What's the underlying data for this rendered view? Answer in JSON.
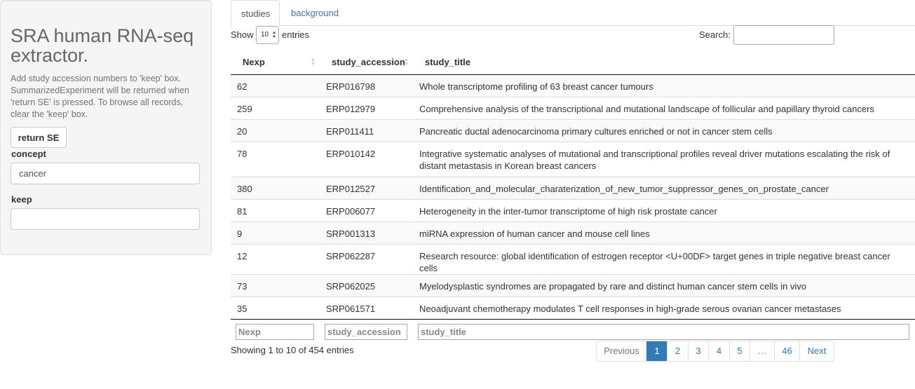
{
  "sidebar": {
    "title": "SRA human RNA-seq extractor.",
    "help": "Add study accession numbers to 'keep' box. SummarizedExperiment will be returned when 'return SE' is pressed. To browse all records, clear the 'keep' box.",
    "return_button": "return SE",
    "concept_label": "concept",
    "concept_value": "cancer",
    "keep_label": "keep",
    "keep_value": ""
  },
  "tabs": [
    {
      "label": "studies",
      "active": true
    },
    {
      "label": "background",
      "active": false
    }
  ],
  "table_controls": {
    "show_label": "Show",
    "length_value": "10",
    "entries_label": "entries",
    "search_label": "Search:",
    "search_value": ""
  },
  "table": {
    "columns": [
      "Nexp",
      "study_accession",
      "study_title"
    ],
    "rows": [
      [
        "62",
        "ERP016798",
        "Whole transcriptome profiling of 63 breast cancer tumours"
      ],
      [
        "259",
        "ERP012979",
        "Comprehensive analysis of the transcriptional and mutational landscape of follicular and papillary thyroid cancers"
      ],
      [
        "20",
        "ERP011411",
        "Pancreatic ductal adenocarcinoma primary cultures enriched or not in cancer stem cells"
      ],
      [
        "78",
        "ERP010142",
        "Integrative systematic analyses of mutational and transcriptional profiles reveal driver mutations escalating the risk of distant metastasis in Korean breast cancers"
      ],
      [
        "380",
        "ERP012527",
        "Identification_and_molecular_charaterization_of_new_tumor_suppressor_genes_on_prostate_cancer"
      ],
      [
        "81",
        "ERP006077",
        "Heterogeneity in the inter-tumor transcriptome of high risk prostate cancer"
      ],
      [
        "9",
        "SRP001313",
        "miRNA expression of human cancer and mouse cell lines"
      ],
      [
        "12",
        "SRP062287",
        "Research resource: global identification of estrogen receptor <U+00DF> target genes in triple negative breast cancer cells"
      ],
      [
        "73",
        "SRP062025",
        "Myelodysplastic syndromes are propagated by rare and distinct human cancer stem cells in vivo"
      ],
      [
        "35",
        "SRP061571",
        "Neoadjuvant chemotherapy modulates T cell responses in high-grade serous ovarian cancer metastases"
      ]
    ],
    "filter_placeholders": [
      "Nexp",
      "study_accession",
      "study_title"
    ]
  },
  "footer": {
    "info": "Showing 1 to 10 of 454 entries",
    "pagination": [
      "Previous",
      "1",
      "2",
      "3",
      "4",
      "5",
      "…",
      "46",
      "Next"
    ],
    "current_page": "1"
  },
  "colors": {
    "link": "#337ab7",
    "sidebar_bg": "#f5f5f5",
    "stripe": "#f9f9f9"
  }
}
